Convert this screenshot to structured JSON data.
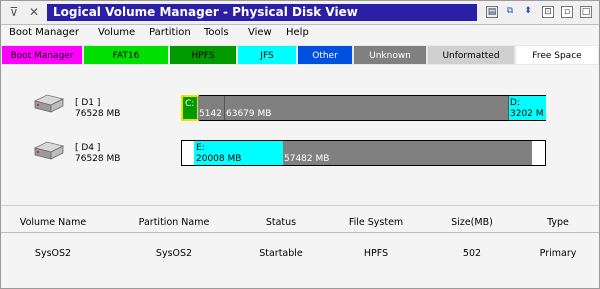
{
  "window": {
    "title": "Logical Volume Manager - Physical Disk View"
  },
  "menu": [
    "Boot Manager",
    "Volume",
    "Partition",
    "Tools",
    "View",
    "Help"
  ],
  "legend": [
    {
      "label": "Boot Manager",
      "color": "#ff00ff"
    },
    {
      "label": "FAT16",
      "color": "#00e000"
    },
    {
      "label": "HPFS",
      "color": "#009a00"
    },
    {
      "label": "JFS",
      "color": "#00ffff"
    },
    {
      "label": "Other",
      "color": "#0050e0"
    },
    {
      "label": "Unknown",
      "color": "#808080"
    },
    {
      "label": "Unformatted",
      "color": "#d0d0d0"
    },
    {
      "label": "Free Space",
      "color": "#ffffff"
    }
  ],
  "disks": [
    {
      "name": "[ D1 ]",
      "size": "76528 MB",
      "partitions": [
        {
          "letter": "C:",
          "size_label": "",
          "color": "#009a00",
          "selected": true
        },
        {
          "letter": "",
          "size_label": "5142",
          "color": "#808080"
        },
        {
          "letter": "",
          "size_label": "63679 MB",
          "color": "#808080"
        },
        {
          "letter": "D:",
          "size_label": "3202 M",
          "color": "#00ffff"
        }
      ]
    },
    {
      "name": "[ D4 ]",
      "size": "76528 MB",
      "partitions": [
        {
          "letter": "E:",
          "size_label": "20008 MB",
          "color": "#00ffff"
        },
        {
          "letter": "",
          "size_label": "57482 MB",
          "color": "#808080"
        }
      ]
    }
  ],
  "table": {
    "headers": [
      "Volume Name",
      "Partition Name",
      "Status",
      "File System",
      "Size(MB)",
      "Type"
    ],
    "rows": [
      [
        "SysOS2",
        "SysOS2",
        "Startable",
        "HPFS",
        "502",
        "Primary"
      ]
    ]
  }
}
